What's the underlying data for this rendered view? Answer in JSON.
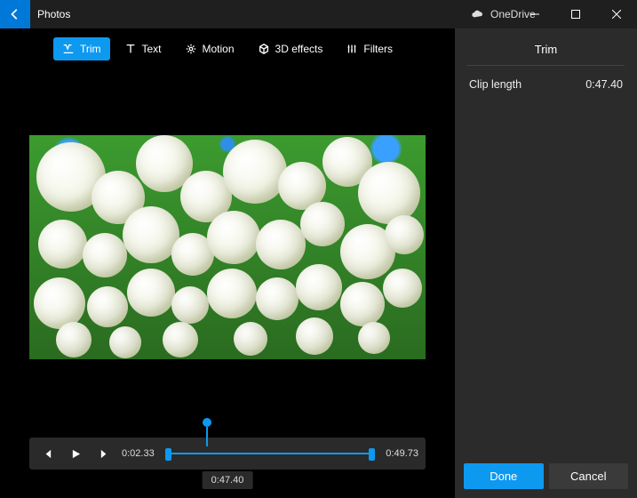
{
  "titlebar": {
    "app_name": "Photos",
    "onedrive_label": "OneDrive"
  },
  "toolbar": {
    "trim": "Trim",
    "text": "Text",
    "motion": "Motion",
    "effects3d": "3D effects",
    "filters": "Filters"
  },
  "playback": {
    "start_time": "0:02.33",
    "end_time": "0:49.73",
    "duration_tip": "0:47.40"
  },
  "panel": {
    "title": "Trim",
    "clip_length_label": "Clip length",
    "clip_length_value": "0:47.40",
    "done": "Done",
    "cancel": "Cancel"
  },
  "colors": {
    "accent": "#0e99f1",
    "back_button": "#0078d7"
  }
}
